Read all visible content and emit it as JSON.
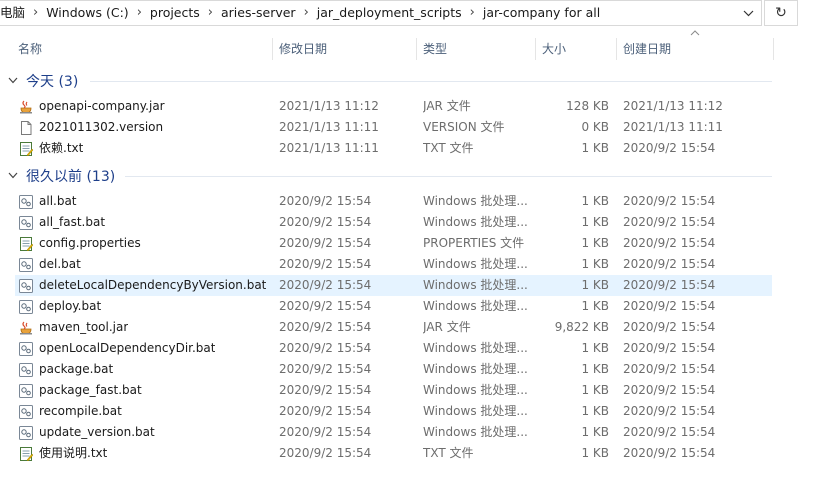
{
  "address": {
    "crumbs": [
      "电脑",
      "Windows (C:)",
      "projects",
      "aries-server",
      "jar_deployment_scripts",
      "jar-company for all"
    ],
    "separator": "›",
    "dropdown_glyph": "⌄",
    "refresh_glyph": "↻"
  },
  "columns": {
    "name": "名称",
    "modified": "修改日期",
    "type": "类型",
    "size": "大小",
    "created": "创建日期"
  },
  "groups": [
    {
      "label": "今天 (3)",
      "expanded": true
    },
    {
      "label": "很久以前 (13)",
      "expanded": true
    }
  ],
  "files_today": [
    {
      "icon": "jar-file-icon",
      "name": "openapi-company.jar",
      "modified": "2021/1/13 11:12",
      "type": "JAR 文件",
      "size": "128 KB",
      "created": "2021/1/13 11:12"
    },
    {
      "icon": "blank-file-icon",
      "name": "2021011302.version",
      "modified": "2021/1/13 11:11",
      "type": "VERSION 文件",
      "size": "0 KB",
      "created": "2021/1/13 11:11"
    },
    {
      "icon": "text-file-icon",
      "name": "依赖.txt",
      "modified": "2021/1/13 11:11",
      "type": "TXT 文件",
      "size": "1 KB",
      "created": "2020/9/2 15:54"
    }
  ],
  "files_old": [
    {
      "icon": "bat-file-icon",
      "name": "all.bat",
      "modified": "2020/9/2 15:54",
      "type": "Windows 批处理...",
      "size": "1 KB",
      "created": "2020/9/2 15:54"
    },
    {
      "icon": "bat-file-icon",
      "name": "all_fast.bat",
      "modified": "2020/9/2 15:54",
      "type": "Windows 批处理...",
      "size": "1 KB",
      "created": "2020/9/2 15:54"
    },
    {
      "icon": "text-file-icon",
      "name": "config.properties",
      "modified": "2020/9/2 15:54",
      "type": "PROPERTIES 文件",
      "size": "1 KB",
      "created": "2020/9/2 15:54"
    },
    {
      "icon": "bat-file-icon",
      "name": "del.bat",
      "modified": "2020/9/2 15:54",
      "type": "Windows 批处理...",
      "size": "1 KB",
      "created": "2020/9/2 15:54"
    },
    {
      "icon": "bat-file-icon",
      "name": "deleteLocalDependencyByVersion.bat",
      "modified": "2020/9/2 15:54",
      "type": "Windows 批处理...",
      "size": "1 KB",
      "created": "2020/9/2 15:54",
      "selected": true
    },
    {
      "icon": "bat-file-icon",
      "name": "deploy.bat",
      "modified": "2020/9/2 15:54",
      "type": "Windows 批处理...",
      "size": "1 KB",
      "created": "2020/9/2 15:54"
    },
    {
      "icon": "jar-file-icon",
      "name": "maven_tool.jar",
      "modified": "2020/9/2 15:54",
      "type": "JAR 文件",
      "size": "9,822 KB",
      "created": "2020/9/2 15:54"
    },
    {
      "icon": "bat-file-icon",
      "name": "openLocalDependencyDir.bat",
      "modified": "2020/9/2 15:54",
      "type": "Windows 批处理...",
      "size": "1 KB",
      "created": "2020/9/2 15:54"
    },
    {
      "icon": "bat-file-icon",
      "name": "package.bat",
      "modified": "2020/9/2 15:54",
      "type": "Windows 批处理...",
      "size": "1 KB",
      "created": "2020/9/2 15:54"
    },
    {
      "icon": "bat-file-icon",
      "name": "package_fast.bat",
      "modified": "2020/9/2 15:54",
      "type": "Windows 批处理...",
      "size": "1 KB",
      "created": "2020/9/2 15:54"
    },
    {
      "icon": "bat-file-icon",
      "name": "recompile.bat",
      "modified": "2020/9/2 15:54",
      "type": "Windows 批处理...",
      "size": "1 KB",
      "created": "2020/9/2 15:54"
    },
    {
      "icon": "bat-file-icon",
      "name": "update_version.bat",
      "modified": "2020/9/2 15:54",
      "type": "Windows 批处理...",
      "size": "1 KB",
      "created": "2020/9/2 15:54"
    },
    {
      "icon": "text-file-icon",
      "name": "使用说明.txt",
      "modified": "2020/9/2 15:54",
      "type": "TXT 文件",
      "size": "1 KB",
      "created": "2020/9/2 15:54"
    }
  ],
  "colors": {
    "group_header": "#1e3f8a",
    "selection": "#e5f3ff",
    "header_text": "#4c607a"
  }
}
